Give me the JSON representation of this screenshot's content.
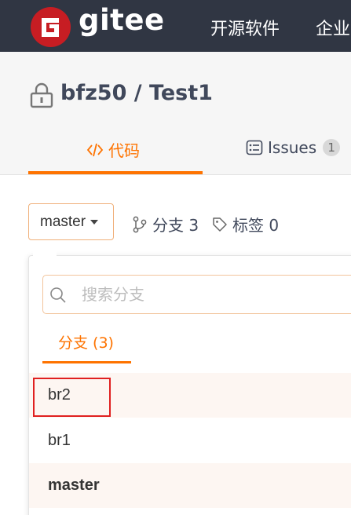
{
  "app": {
    "logo_text": "gitee",
    "nav_items": [
      "开源软件",
      "企业"
    ]
  },
  "repo": {
    "title": "bfz50 / Test1"
  },
  "tabs": {
    "code_label": "代码",
    "issues_label": "Issues",
    "issues_count": "1"
  },
  "branch_bar": {
    "current_branch": "master",
    "branches_label": "分支 3",
    "tags_label": "标签 0"
  },
  "dropdown": {
    "search_placeholder": "搜索分支",
    "tab_label": "分支 (3)",
    "branches": [
      "br2",
      "br1",
      "master"
    ]
  },
  "colors": {
    "accent": "#fe7300",
    "nav_bg": "#303643",
    "logo_red": "#c71d23",
    "highlight": "#e02020"
  }
}
